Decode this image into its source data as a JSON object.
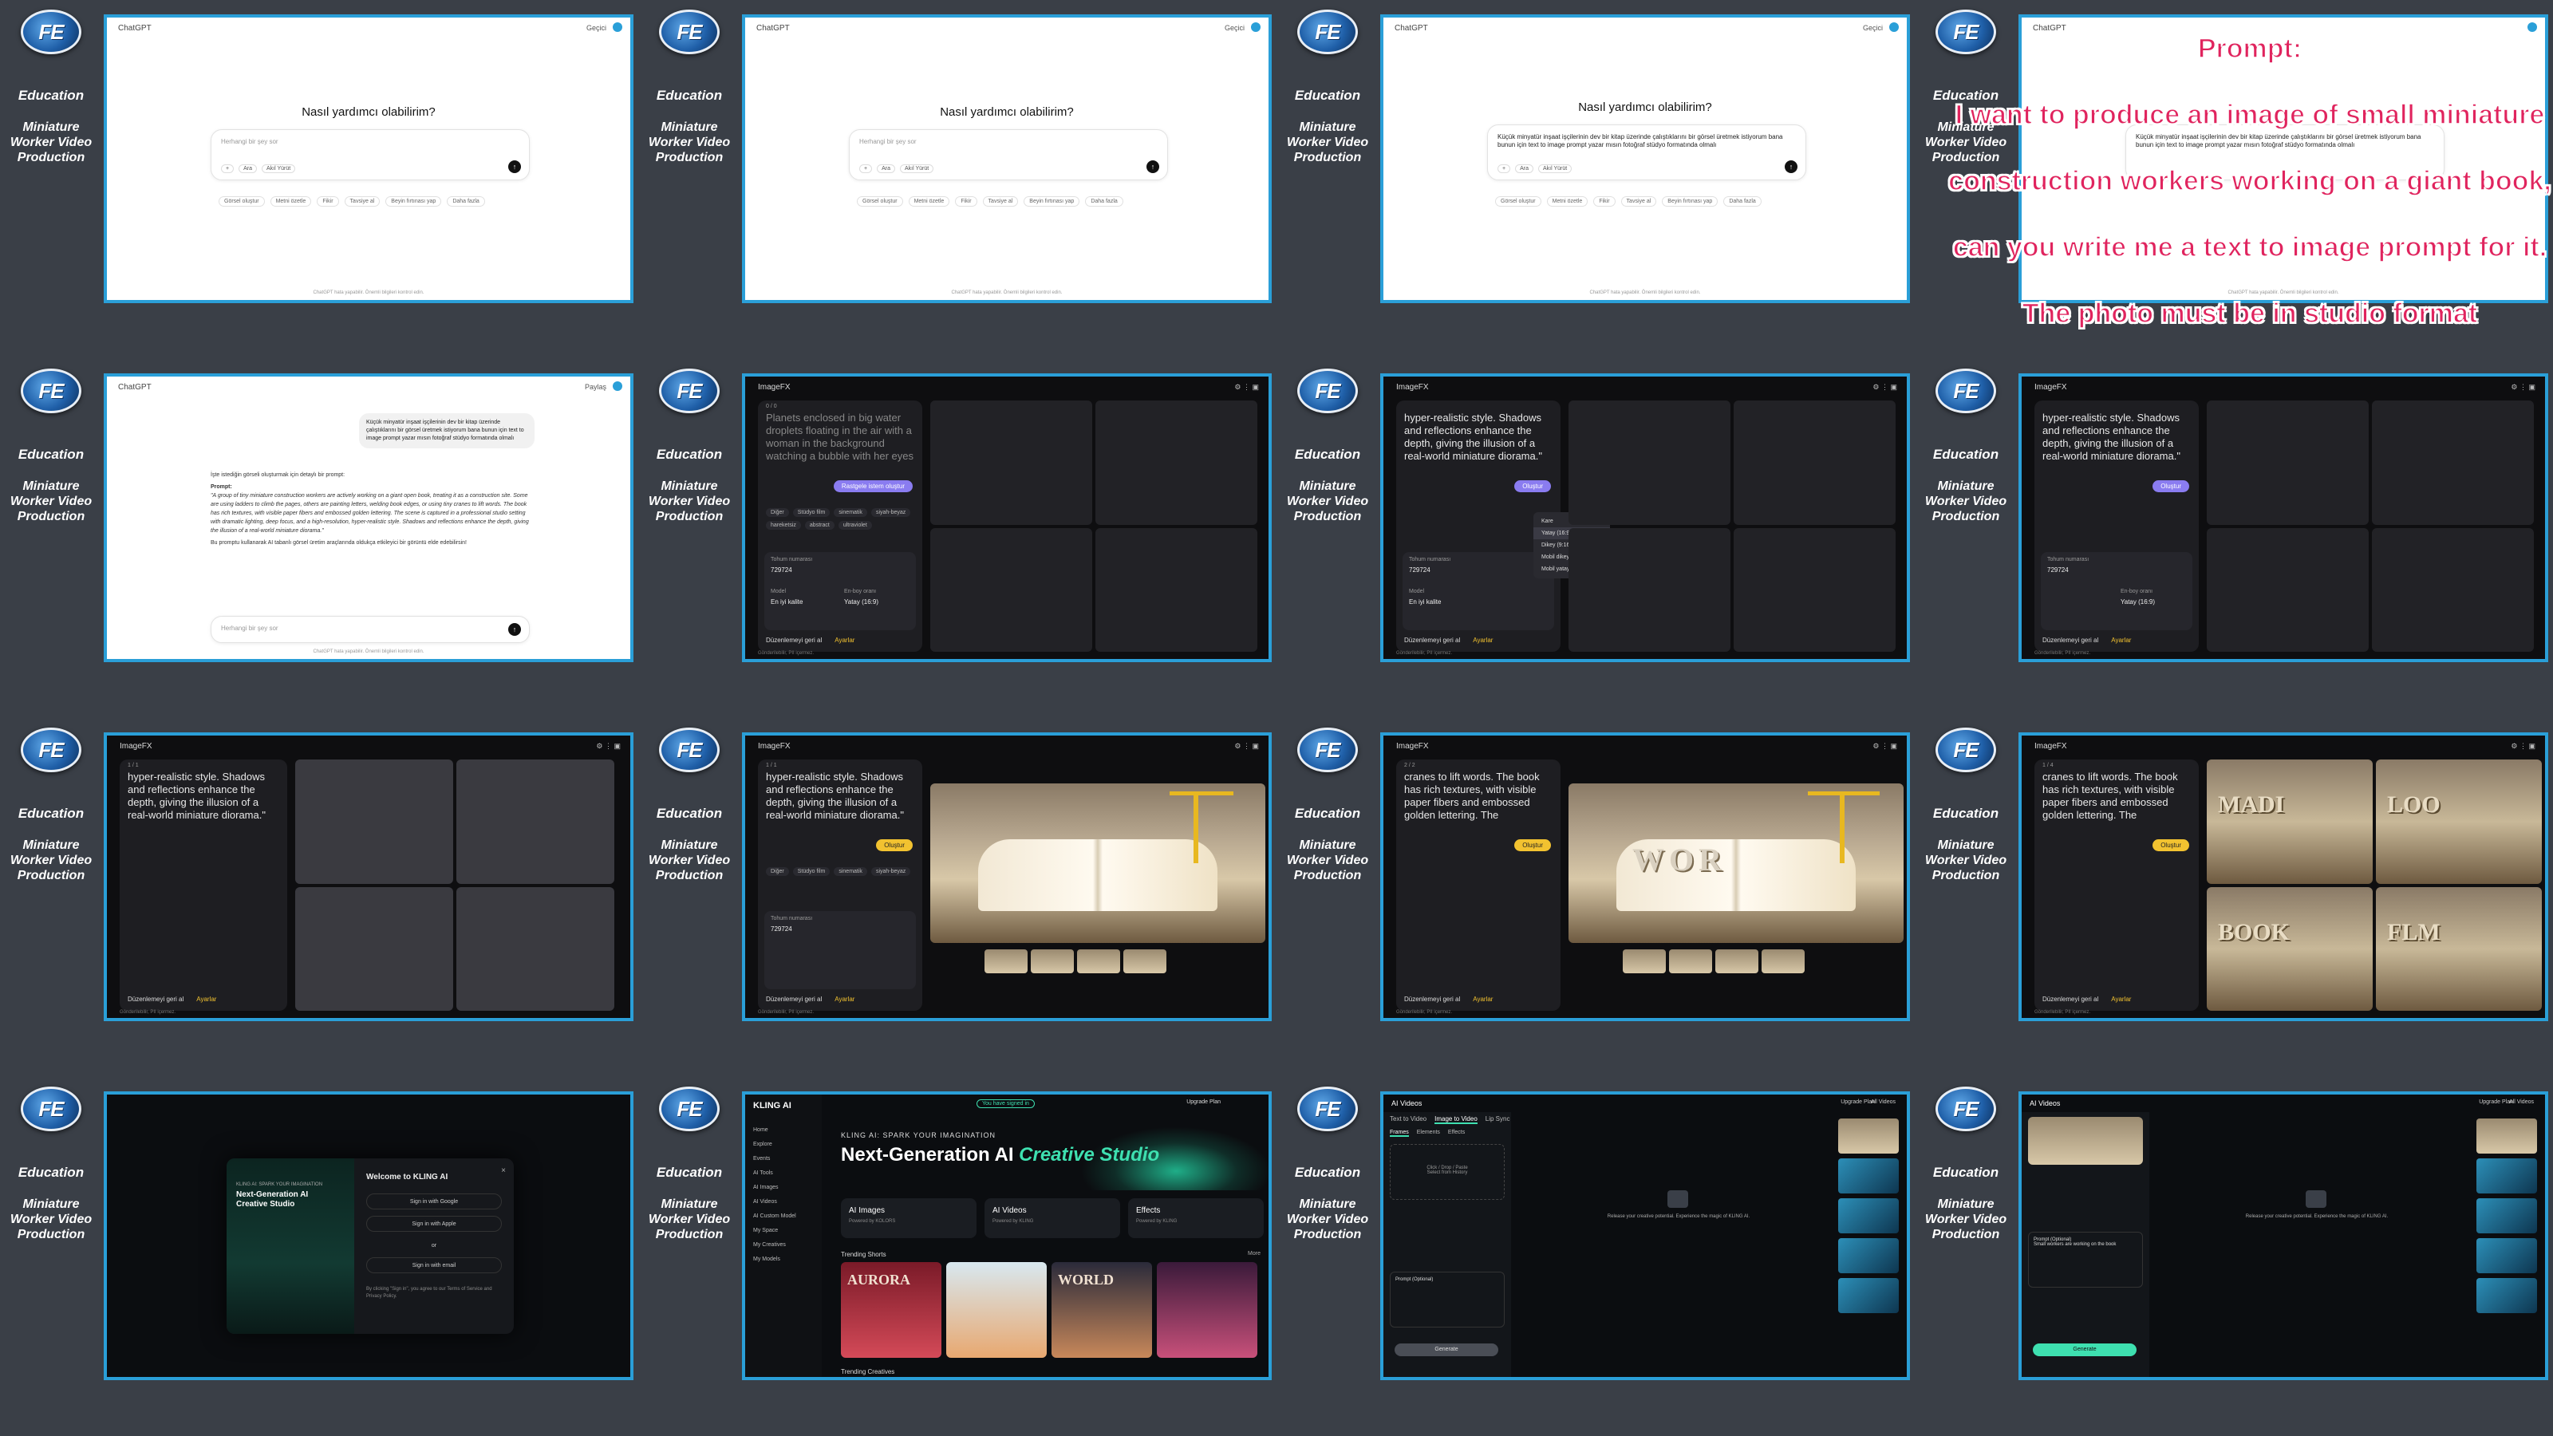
{
  "sidebar": {
    "logo": "FE",
    "education": "Education",
    "subtitle": "Miniature Worker Video Production"
  },
  "chatgpt": {
    "app_name": "ChatGPT",
    "share": "Geçici",
    "share_alt": "Paylaş",
    "heading": "Nasıl yardımcı olabilirim?",
    "placeholder": "Herhangi bir şey sor",
    "tools": [
      "+",
      "Ara",
      "Akıl Yürüt"
    ],
    "chips": [
      "Görsel oluştur",
      "Metni özetle",
      "Fikir",
      "Tavsiye al",
      "Beyin fırtınası yap",
      "Daha fazla"
    ],
    "typed_query": "Küçük minyatür inşaat işçilerinin dev bir kitap üzerinde çalıştıklarını bir görsel üretmek istiyorum bana bunun için text to image prompt yazar mısın fotoğraf stüdyo formatında olmalı",
    "footer": "ChatGPT hata yapabilir. Önemli bilgileri kontrol edin.",
    "answer_intro": "İşte istediğin görseli oluşturmak için detaylı bir prompt:",
    "answer_label": "Prompt:",
    "answer_body": "\"A group of tiny miniature construction workers are actively working on a giant open book, treating it as a construction site. Some are using ladders to climb the pages, others are painting letters, welding book edges, or using tiny cranes to lift words. The book has rich textures, with visible paper fibers and embossed golden lettering. The scene is captured in a professional studio setting with dramatic lighting, deep focus, and a high-resolution, hyper-realistic style. Shadows and reflections enhance the depth, giving the illusion of a real-world miniature diorama.\"",
    "answer_outro": "Bu promptu kullanarak AI tabanlı görsel üretim araçlarında oldukça etkileyici bir görüntü elde edebilirsin!"
  },
  "overlay": {
    "lines": [
      "Prompt:",
      "I want to produce an image of small miniature",
      "construction workers working on a giant book,",
      "can you write me a text to image prompt for it.",
      "The photo must be in studio format"
    ]
  },
  "imagefx": {
    "app_name": "ImageFX",
    "counter_a": "0 / 0",
    "counter_b": "1 / 1",
    "counter_c": "2 / 2",
    "counter_d": "1 / 4",
    "placeholder_text": "Planets enclosed in big water droplets floating in the air with a woman in the background watching a bubble with her eyes",
    "prompt_tail": "hyper-realistic style. Shadows and reflections enhance the depth, giving the illusion of a real-world miniature diorama.\"",
    "prompt_tail_b": "cranes to lift words. The book has rich textures, with visible paper fibers and embossed golden lettering. The",
    "generate_btn": "Oluştur",
    "random_btn": "Rastgele istem oluştur",
    "tags": [
      "Diğer",
      "Stüdyo film",
      "sinematik",
      "siyah-beyaz",
      "hareketsiz",
      "abstract",
      "ultraviolet"
    ],
    "seed_label": "Tohum numarası",
    "seed_value": "729724",
    "model_label": "Model",
    "model_value": "En iyi kalite",
    "ratio_label": "En-boy oranı",
    "ratio_value": "Yatay (16:9)",
    "ratio_menu": [
      "Kare",
      "Yatay (16:9)",
      "Dikey (9:16)",
      "Mobil dikey (3:4)",
      "Mobil yatay (4:3)"
    ],
    "bottom_left": "Düzenlemeyi geri al",
    "bottom_right": "Ayarlar",
    "footer": "Gönderilebilir, PII içermez.",
    "word_a": "WOR",
    "grid_words": [
      "MADI",
      "LOO",
      "BOOK",
      "FLM"
    ]
  },
  "kling": {
    "app_name": "KLING AI",
    "hero_small": "KLING AI: SPARK YOUR IMAGINATION",
    "hero_main": "Next-Generation AI",
    "hero_accent": "Creative Studio",
    "badge": "You have signed in",
    "upgrade": "Upgrade Plan",
    "nav": [
      "Home",
      "Explore",
      "Events",
      "AI Tools",
      "AI Images",
      "AI Videos",
      "AI Custom Model",
      "My Space",
      "My Creatives",
      "My Models"
    ],
    "cards": [
      {
        "title": "AI Images",
        "sub": "Powered by KOLORS"
      },
      {
        "title": "AI Videos",
        "sub": "Powered by KLING"
      },
      {
        "title": "Effects",
        "sub": "Powered by KLING"
      }
    ],
    "section_shorts": "Trending Shorts",
    "section_creatives": "Trending Creatives",
    "more": "More",
    "tiles": [
      "AURORA",
      "",
      "WORLD",
      ""
    ],
    "modal_welcome": "Welcome to KLING AI",
    "modal_small": "KLING AI: SPARK YOUR IMAGINATION",
    "modal_big": "Next-Generation AI Creative Studio",
    "modal_options": [
      "Sign in with Google",
      "Sign in with Apple",
      "or",
      "Sign in with email"
    ],
    "modal_terms": "By clicking \"Sign in\", you agree to our Terms of Service and Privacy Policy.",
    "video_header": "AI Videos",
    "video_tabs": [
      "Text to Video",
      "Image to Video",
      "Lip Sync"
    ],
    "sub_tabs": [
      "Frames",
      "Elements",
      "Effects"
    ],
    "drop_text": "Click / Drop / Paste",
    "drop_sub": "Select from History",
    "center_text": "Release your creative potential. Experience the magic of KLING AI.",
    "prompt_label": "Prompt (Optional)",
    "prompt_text": "Small workers are working on the book",
    "generate": "Generate",
    "all_videos": "All Videos"
  },
  "colors": {
    "bg": "#3a3f47",
    "frame": "#2a9fd8",
    "overlay_text": "#e0245e",
    "kling_accent": "#3ee0b0",
    "fx_accent": "#f2c230"
  }
}
